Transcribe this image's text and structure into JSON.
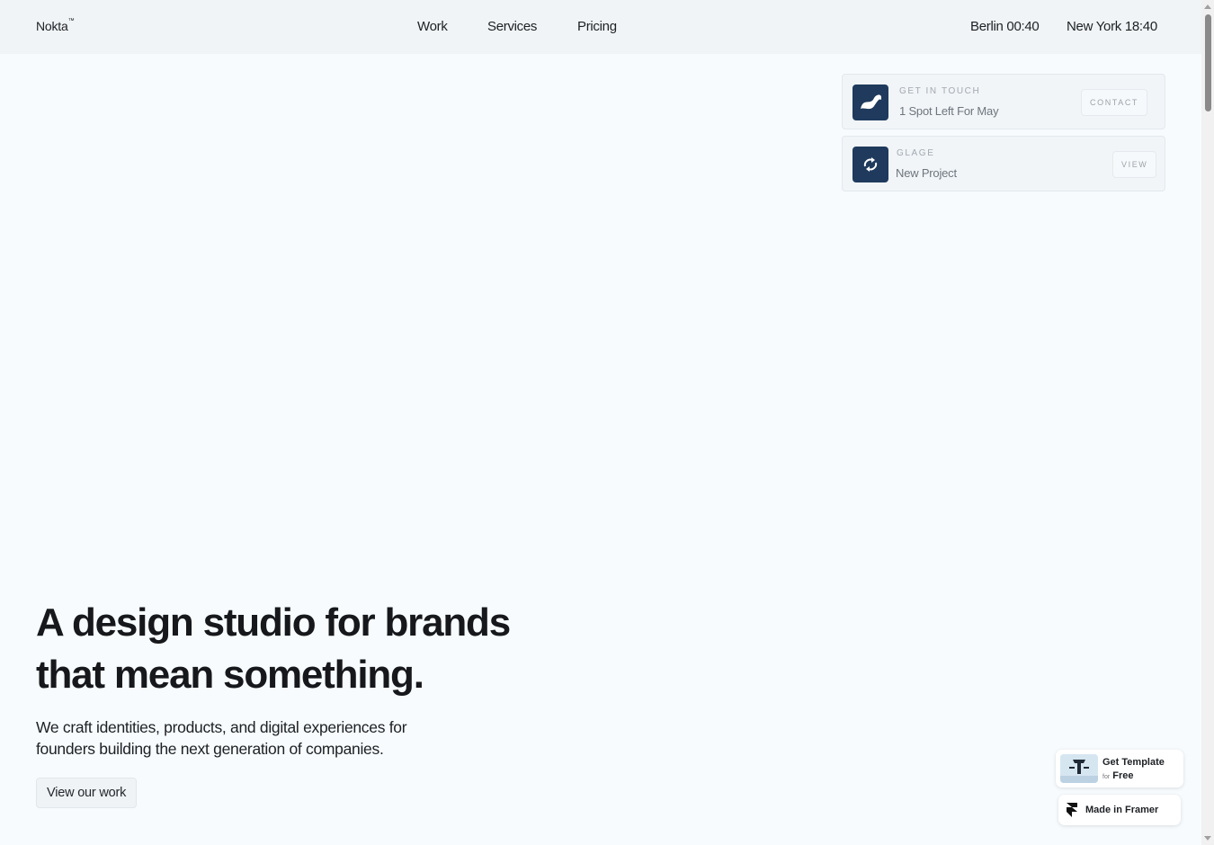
{
  "header": {
    "logo": "Nokta",
    "logo_mark": "™",
    "nav": [
      "Work",
      "Services",
      "Pricing"
    ],
    "clocks": [
      "Berlin 00:40",
      "New York 18:40"
    ]
  },
  "cards": [
    {
      "eyebrow": "GET IN TOUCH",
      "subtitle": "1 Spot Left For May",
      "action": "CONTACT",
      "icon": "swirl-logo-icon"
    },
    {
      "eyebrow": "GLAGE",
      "subtitle": "New Project",
      "action": "VIEW",
      "icon": "circle-arrows-logo-icon"
    }
  ],
  "hero": {
    "title_line1": "A design studio for brands",
    "title_line2": "that mean something.",
    "subtitle_line1": "We craft identities, products, and digital experiences for",
    "subtitle_line2": "founders building the next generation of companies.",
    "cta": "View our work"
  },
  "badges": {
    "template_line1": "Get Template",
    "template_for": "for",
    "template_free": "Free",
    "made_in": "Made in Framer"
  },
  "colors": {
    "page_bg": "#f7fbfd",
    "header_bg": "#f1f4f6",
    "card_icon_bg": "#1f3a5c",
    "text": "#16181b"
  }
}
